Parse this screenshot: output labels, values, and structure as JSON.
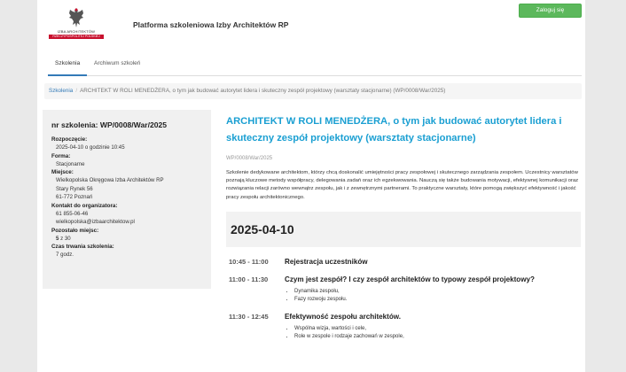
{
  "header": {
    "logo_text": "IZBA ARCHITEKTÓW",
    "logo_subtext": "RZECZYPOSPOLITEJ POLSKIEJ",
    "site_title": "Platforma szkoleniowa Izby Architektów RP",
    "login_label": "Zaloguj się"
  },
  "tabs": [
    {
      "label": "Szkolenia",
      "active": true
    },
    {
      "label": "Archiwum szkoleń",
      "active": false
    }
  ],
  "breadcrumb": {
    "link": "Szkolenia",
    "separator": "/",
    "current": "ARCHITEKT W ROLI MENEDŻERA, o tym jak budować autorytet lidera i skuteczny zespół projektowy (warsztaty stacjonarne) (WP/0008/War/2025)"
  },
  "sidebar": {
    "title": "nr szkolenia: WP/0008/War/2025",
    "fields": [
      {
        "label": "Rozpoczęcie:",
        "values": [
          "2025-04-10 o godzinie 10:45"
        ]
      },
      {
        "label": "Forma:",
        "values": [
          "Stacjonarne"
        ]
      },
      {
        "label": "Miejsce:",
        "values": [
          "Wielkopolska Okręgowa Izba Architektów RP",
          "Stary Rynek 56",
          "61-772 Poznań"
        ]
      },
      {
        "label": "Kontakt do organizatora:",
        "values": [
          "61 855-06-46",
          "wielkopolska@izbaarchitektow.pl"
        ]
      },
      {
        "label": "Pozostało miejsc:",
        "values": []
      },
      {
        "label": "Czas trwania szkolenia:",
        "values": [
          "7 godz."
        ]
      }
    ],
    "seats_available": "5",
    "seats_total": "z 30"
  },
  "main": {
    "title": "ARCHITEKT W ROLI MENEDŻERA, o tym jak budować autorytet lidera i skuteczny zespół projektowy (warsztaty stacjonarne)",
    "code": "WP/0008/War/2025",
    "description": "Szkolenie dedykowane architektom, którzy chcą doskonalić umiejętności pracy zespołowej i skutecznego zarządzania zespołem. Uczestnicy warsztatów poznają kluczowe metody współpracy, delegowania zadań oraz ich egzekwowania. Nauczą się także budowania motywacji, efektywnej komunikacji oraz rozwiązania relacji zarówno wewnątrz zespołu, jak i z zewnętrznymi partnerami. To praktyczne warsztaty, które pomogą zwiększyć efektywność i jakość pracy zespołu architektonicznego.",
    "date": "2025-04-10",
    "schedule": [
      {
        "time": "10:45 - 11:00",
        "title": "Rejestracja uczestników",
        "bullets": []
      },
      {
        "time": "11:00 - 11:30",
        "title": "Czym jest zespół? I czy zespół architektów to typowy zespół projektowy?",
        "bullets": [
          "Dynamika zespołu,",
          "Fazy rozwoju zespołu."
        ]
      },
      {
        "time": "11:30 - 12:45",
        "title": "Efektywność zespołu architektów.",
        "bullets": [
          "Wspólna wizja, wartości i cele,",
          "Role w zespole i rodzaje zachowań w zespole,"
        ]
      }
    ]
  },
  "colors": {
    "accent": "#337ab7",
    "title": "#1a9fd2",
    "login": "#5cb85c",
    "logo_red": "#c8102e"
  }
}
